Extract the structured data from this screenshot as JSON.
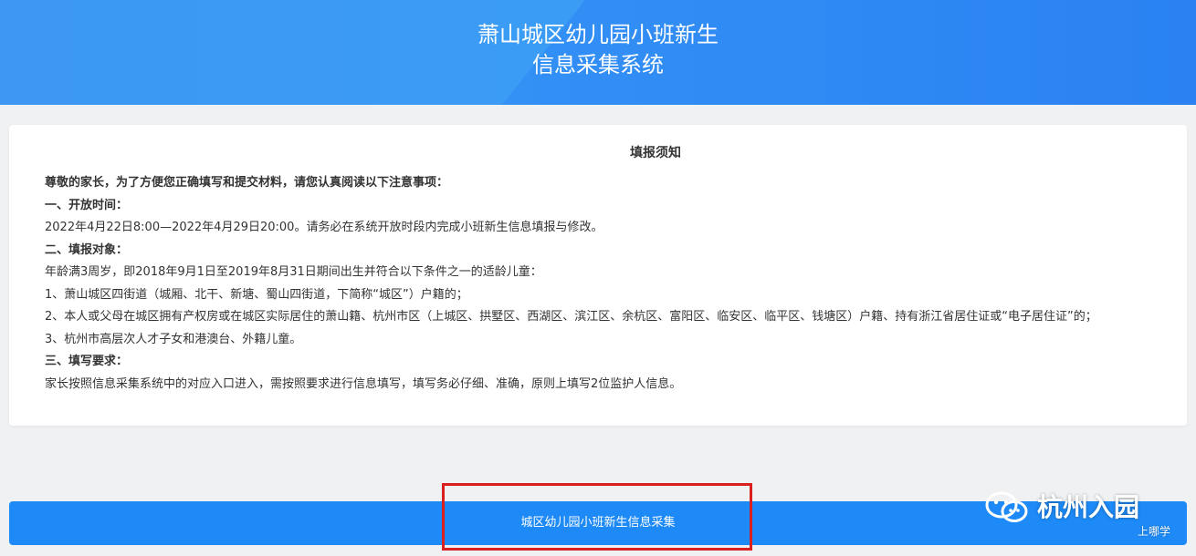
{
  "header": {
    "title_line1": "萧山城区幼儿园小班新生",
    "title_line2": "信息采集系统",
    "colors": {
      "primary": "#2f8ff5",
      "button": "#1d8af7",
      "highlight": "#d9201f"
    }
  },
  "notice": {
    "title": "填报须知",
    "greeting": "尊敬的家长，为了方便您正确填写和提交材料，请您认真阅读以下注意事项：",
    "section1_heading": "一、开放时间：",
    "section1_text": "2022年4月22日8:00—2022年4月29日20:00。请务必在系统开放时段内完成小班新生信息填报与修改。",
    "section2_heading": "二、填报对象：",
    "section2_intro": "年龄满3周岁，即2018年9月1日至2019年8月31日期间出生并符合以下条件之一的适龄儿童：",
    "section2_item1": "1、萧山城区四街道（城厢、北干、新塘、蜀山四街道，下简称“城区”）户籍的；",
    "section2_item2": "2、本人或父母在城区拥有产权房或在城区实际居住的萧山籍、杭州市区（上城区、拱墅区、西湖区、滨江区、余杭区、富阳区、临安区、临平区、钱塘区）户籍、持有浙江省居住证或“电子居住证”的；",
    "section2_item3": "3、杭州市高层次人才子女和港澳台、外籍儿童。",
    "section3_heading": "三、填写要求：",
    "section3_text": "家长按照信息采集系统中的对应入口进入，需按照要求进行信息填写，填写务必仔细、准确，原则上填写2位监护人信息。"
  },
  "submit": {
    "label": "城区幼儿园小班新生信息采集"
  },
  "watermark": {
    "icon": "wechat-icon",
    "text": "杭州入园",
    "sub": "上哪学"
  }
}
